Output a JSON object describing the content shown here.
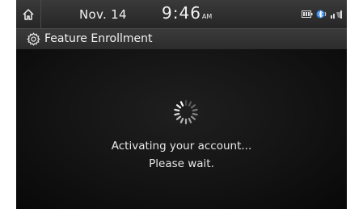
{
  "status_bar": {
    "date": "Nov. 14",
    "time": "9:46",
    "ampm": "AM",
    "icons": [
      "home-icon",
      "battery-icon",
      "bluetooth-icon",
      "signal-icon"
    ]
  },
  "title_bar": {
    "icon": "gear-icon",
    "title": "Feature Enrollment"
  },
  "content": {
    "message_line1": "Activating your account...",
    "message_line2": "Please wait.",
    "indicator": "loading-spinner"
  },
  "colors": {
    "background": "#0c0c0c",
    "bar": "#2c2c2c",
    "text": "#f2f2f2",
    "accent": "#4aa3ff"
  }
}
